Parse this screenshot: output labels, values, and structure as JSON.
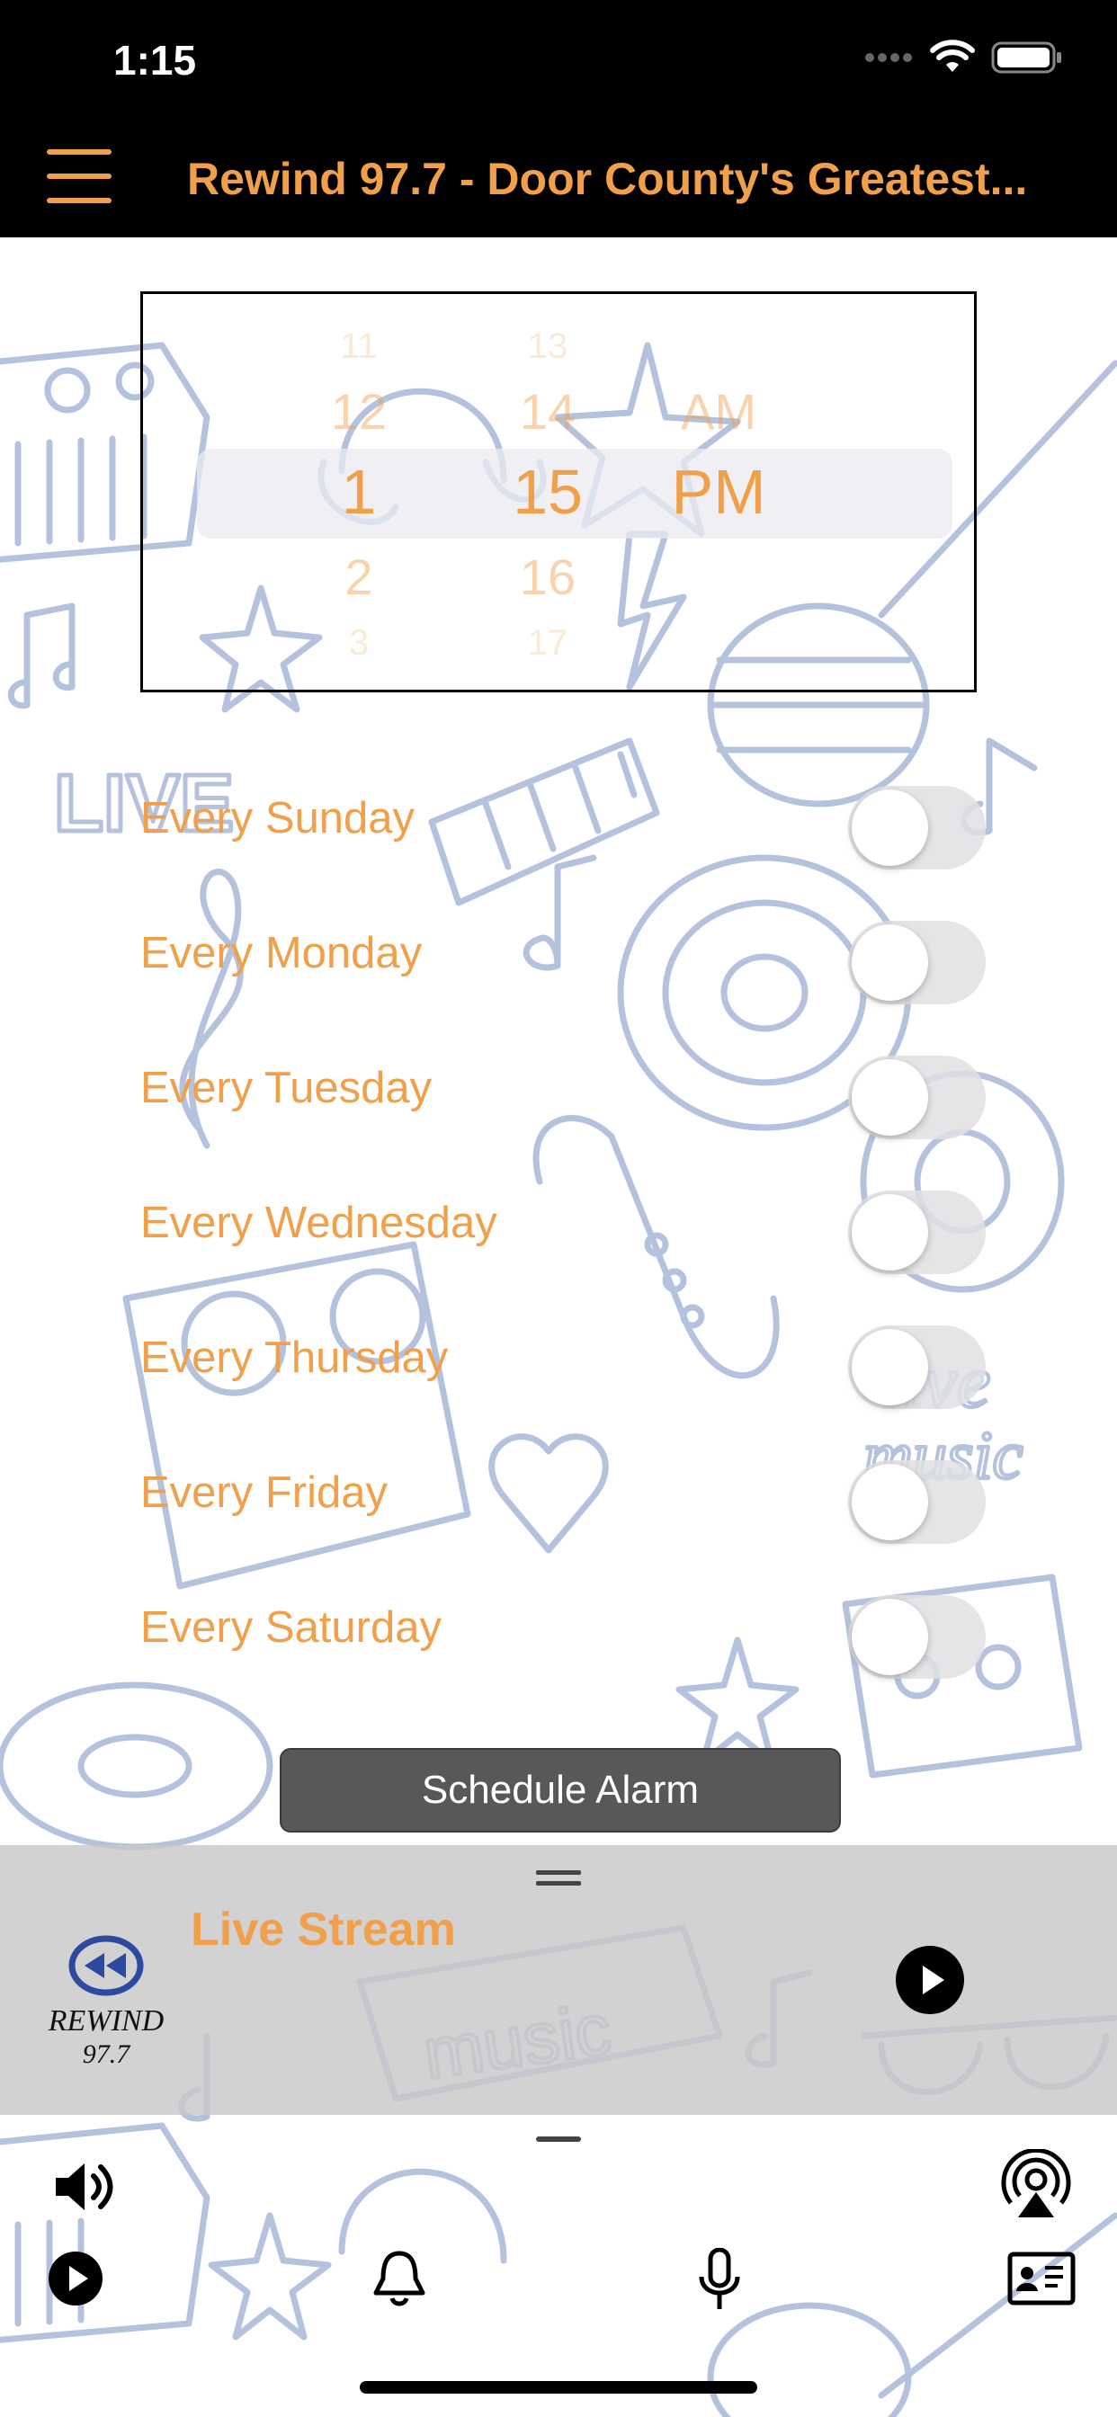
{
  "status_bar": {
    "time": "1:15"
  },
  "nav": {
    "title": "Rewind 97.7 - Door County's Greatest..."
  },
  "time_picker": {
    "hours": [
      "11",
      "12",
      "1",
      "2",
      "3"
    ],
    "minutes": [
      "13",
      "14",
      "15",
      "16",
      "17"
    ],
    "meridiem": [
      "AM",
      "PM"
    ],
    "selected": {
      "hour": "1",
      "minute": "15",
      "meridiem": "PM"
    }
  },
  "days": [
    {
      "label": "Every Sunday",
      "enabled": false
    },
    {
      "label": "Every Monday",
      "enabled": false
    },
    {
      "label": "Every Tuesday",
      "enabled": false
    },
    {
      "label": "Every Wednesday",
      "enabled": false
    },
    {
      "label": "Every Thursday",
      "enabled": false
    },
    {
      "label": "Every Friday",
      "enabled": false
    },
    {
      "label": "Every Saturday",
      "enabled": false
    }
  ],
  "schedule_button": {
    "label": "Schedule Alarm"
  },
  "player": {
    "title": "Live Stream",
    "logo_text": [
      "REWIND",
      "97.7"
    ]
  },
  "colors": {
    "accent": "#f0a04b",
    "doodle": "#a8b8d8"
  },
  "icons": [
    "menu-icon",
    "volume-icon",
    "airplay-icon",
    "play-icon",
    "bell-icon",
    "microphone-icon",
    "contact-card-icon"
  ]
}
